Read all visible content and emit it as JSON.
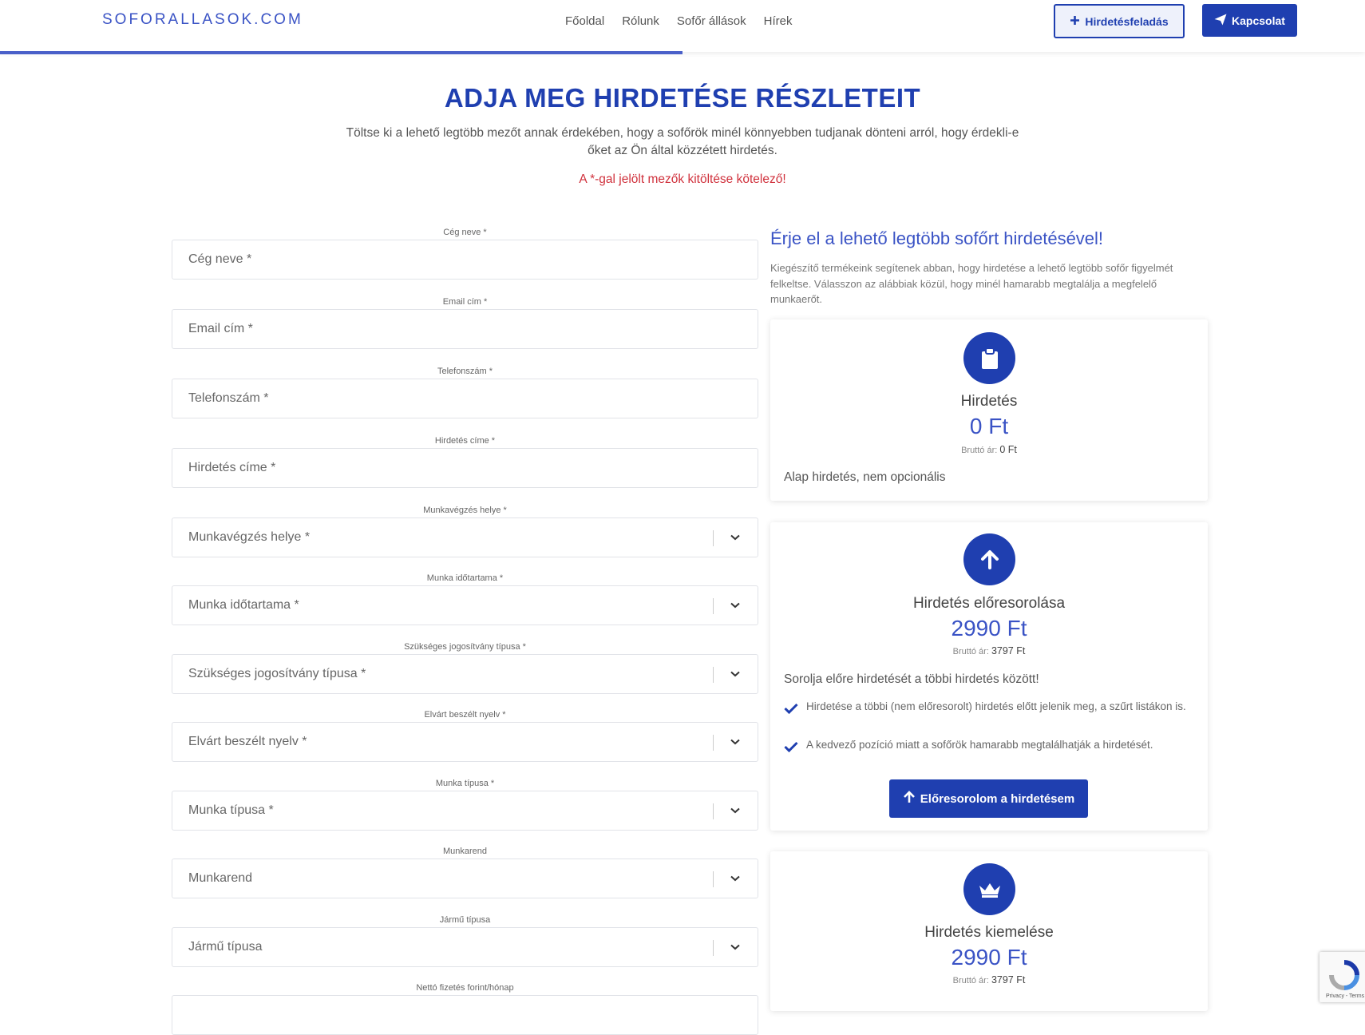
{
  "header": {
    "brand": "SOFORALLASOK.COM",
    "nav": [
      "Főoldal",
      "Rólunk",
      "Sofőr állások",
      "Hírek"
    ],
    "post_button": "Hirdetésfeladás",
    "contact_button": "Kapcsolat",
    "progress_fraction": 0.5
  },
  "intro": {
    "title": "ADJA MEG HIRDETÉSE RÉSZLETEIT",
    "subtitle": "Töltse ki a lehető legtöbb mezőt annak érdekében, hogy a sofőrök minél könnyebben tudjanak dönteni arról, hogy érdekli-e őket az Ön által közzétett hirdetés.",
    "required_note": "A *-gal jelölt mezők kitöltése kötelező!"
  },
  "form": {
    "fields": [
      {
        "label": "Cég neve *",
        "placeholder": "Cég neve *",
        "type": "text"
      },
      {
        "label": "Email cím *",
        "placeholder": "Email cím *",
        "type": "text"
      },
      {
        "label": "Telefonszám *",
        "placeholder": "Telefonszám *",
        "type": "text"
      },
      {
        "label": "Hirdetés címe *",
        "placeholder": "Hirdetés címe *",
        "type": "text"
      },
      {
        "label": "Munkavégzés helye *",
        "placeholder": "Munkavégzés helye *",
        "type": "select"
      },
      {
        "label": "Munka időtartama *",
        "placeholder": "Munka időtartama *",
        "type": "select"
      },
      {
        "label": "Szükséges jogosítvány típusa *",
        "placeholder": "Szükséges jogosítvány típusa *",
        "type": "select"
      },
      {
        "label": "Elvárt beszélt nyelv *",
        "placeholder": "Elvárt beszélt nyelv *",
        "type": "select"
      },
      {
        "label": "Munka típusa *",
        "placeholder": "Munka típusa *",
        "type": "select"
      },
      {
        "label": "Munkarend",
        "placeholder": "Munkarend",
        "type": "select"
      },
      {
        "label": "Jármű típusa",
        "placeholder": "Jármű típusa",
        "type": "select"
      },
      {
        "label": "Nettó fizetés forint/hónap",
        "placeholder": "",
        "type": "text"
      }
    ]
  },
  "side": {
    "title": "Érje el a lehető legtöbb sofőrt hirdetésével!",
    "description": "Kiegészítő termékeink segítenek abban, hogy hirdetése a lehető legtöbb sofőr figyelmét felkeltse. Válasszon az alábbiak közül, hogy minél hamarabb megtalálja a megfelelő munkaerőt.",
    "gross_label": "Bruttó ár:",
    "cards": [
      {
        "icon": "clipboard-icon",
        "name": "Hirdetés",
        "price": "0 Ft",
        "gross": "0 Ft",
        "desc": "Alap hirdetés, nem opcionális"
      },
      {
        "icon": "arrow-up-icon",
        "name": "Hirdetés előresorolása",
        "price": "2990 Ft",
        "gross": "3797 Ft",
        "desc": "Sorolja előre hirdetését a többi hirdetés között!",
        "checks": [
          "Hirdetése a többi (nem előresorolt) hirdetés előtt jelenik meg, a szűrt listákon is.",
          "A kedvező pozíció miatt a sofőrök hamarabb megtalálhatják a hirdetését."
        ],
        "button": "Előresorolom a hirdetésem"
      },
      {
        "icon": "crown-icon",
        "name": "Hirdetés kiemelése",
        "price": "2990 Ft",
        "gross": "3797 Ft"
      }
    ]
  },
  "recaptcha": {
    "text": "Privacy - Terms"
  },
  "colors": {
    "primary": "#1f3fb0",
    "accent": "#3a53c5",
    "required": "#d0313c"
  }
}
